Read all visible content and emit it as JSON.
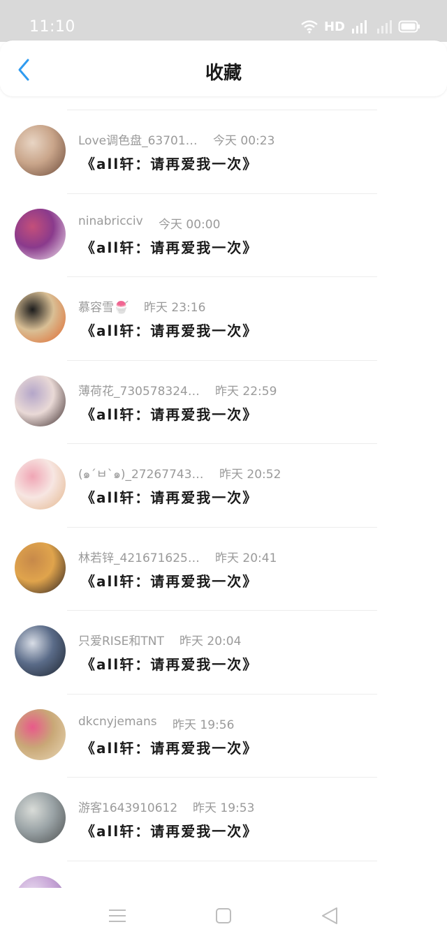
{
  "status_bar": {
    "time": "11:10",
    "network": "HD",
    "signal": "4G"
  },
  "header": {
    "title": "收藏",
    "back_icon": "chevron-left-icon",
    "accent": "#2f9bf0"
  },
  "items": [
    {
      "username": "Love调色盘_63701…",
      "time": "今天 00:23",
      "message": "《all轩：请再爱我一次》",
      "avatar_colors": [
        "#c9a58a",
        "#6b4a3a",
        "#e8d5c4"
      ]
    },
    {
      "username": "ninabricciv",
      "time": "今天 00:00",
      "message": "《all轩：请再爱我一次》",
      "avatar_colors": [
        "#8a3a8c",
        "#f2e6ef",
        "#c44f7a"
      ]
    },
    {
      "username": "慕容雪🍧",
      "time": "昨天 23:16",
      "message": "《all轩：请再爱我一次》",
      "avatar_colors": [
        "#d9bf95",
        "#e0662b",
        "#1c1c1c"
      ]
    },
    {
      "username": "薄荷花_730578324…",
      "time": "昨天 22:59",
      "message": "《all轩：请再爱我一次》",
      "avatar_colors": [
        "#e9d9d6",
        "#3a2a2a",
        "#b4a6c9"
      ]
    },
    {
      "username": "(๑´ㅂ`๑)_27267743…",
      "time": "昨天 20:52",
      "message": "《all轩：请再爱我一次》",
      "avatar_colors": [
        "#f7e6e2",
        "#e3b58a",
        "#f0a6b5"
      ]
    },
    {
      "username": "林若锌_421671625…",
      "time": "昨天 20:41",
      "message": "《all轩：请再爱我一次》",
      "avatar_colors": [
        "#e0a44c",
        "#2a2020",
        "#c7894a"
      ]
    },
    {
      "username": "只爱RISE和TNT",
      "time": "昨天 20:04",
      "message": "《all轩：请再爱我一次》",
      "avatar_colors": [
        "#5a6b88",
        "#1e2530",
        "#d8dde6"
      ]
    },
    {
      "username": "dkcnyjemans",
      "time": "昨天 19:56",
      "message": "《all轩：请再爱我一次》",
      "avatar_colors": [
        "#c9a877",
        "#e9d7b6",
        "#e85a8a"
      ]
    },
    {
      "username": "游客1643910612",
      "time": "昨天 19:53",
      "message": "《all轩：请再爱我一次》",
      "avatar_colors": [
        "#9aa3a6",
        "#4c4f4f",
        "#d9dcd8"
      ]
    },
    {
      "username": "",
      "time": "",
      "message": "",
      "avatar_colors": [
        "#c9a8d8",
        "#8a6aa8",
        "#e8dcef"
      ]
    }
  ],
  "nav_bar": {
    "menu_icon": "menu-icon",
    "home_icon": "square-icon",
    "back_icon": "triangle-back-icon"
  }
}
